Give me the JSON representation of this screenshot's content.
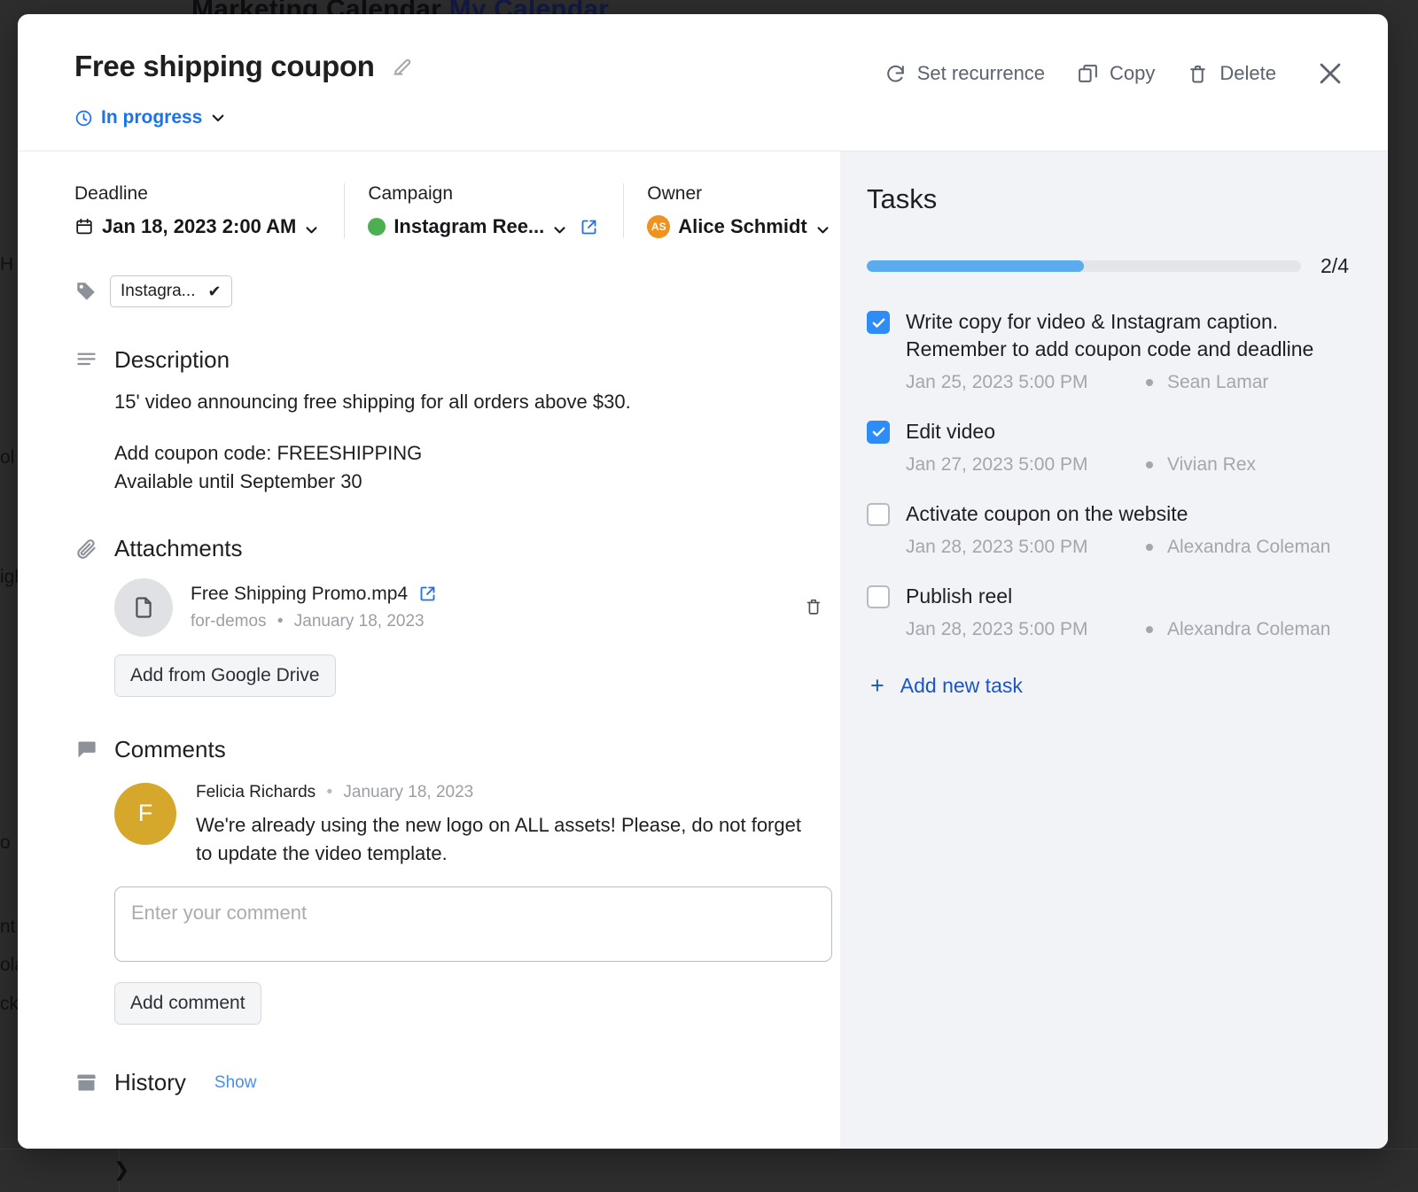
{
  "background": {
    "app_title": "Marketing Calendar",
    "app_subtitle": "My Calendar",
    "ghost_texts": [
      "H",
      "ol",
      "igh",
      "o",
      "nt",
      "ola",
      "ck"
    ]
  },
  "header": {
    "title": "Free shipping coupon",
    "edit_icon": "pencil-icon",
    "status": {
      "label": "In progress",
      "icon": "clock-icon",
      "color": "#1a73e8"
    },
    "actions": [
      {
        "label": "Set recurrence",
        "icon": "refresh-icon"
      },
      {
        "label": "Copy",
        "icon": "copy-icon"
      },
      {
        "label": "Delete",
        "icon": "trash-icon"
      }
    ],
    "close_icon": "close-icon"
  },
  "meta": {
    "deadline": {
      "label": "Deadline",
      "value": "Jan 18, 2023 2:00 AM",
      "icon": "calendar-icon"
    },
    "campaign": {
      "label": "Campaign",
      "value": "Instagram Ree...",
      "dot_color": "#4caf50",
      "external_icon": "external-link-icon"
    },
    "owner": {
      "label": "Owner",
      "value": "Alice Schmidt",
      "initials": "AS",
      "avatar_color": "#f0921f"
    }
  },
  "tag": {
    "icon": "tag-icon",
    "label": "Instagra...",
    "check": "✔"
  },
  "description": {
    "heading": "Description",
    "icon": "list-icon",
    "line1": "15' video announcing free shipping for all orders above $30.",
    "line2": "Add coupon code: FREESHIPPING",
    "line3": "Available until September 30"
  },
  "attachments": {
    "heading": "Attachments",
    "icon": "paperclip-icon",
    "items": [
      {
        "name": "Free Shipping Promo.mp4",
        "folder": "for-demos",
        "date": "January 18, 2023",
        "separator": "•",
        "open_icon": "external-link-icon",
        "delete_icon": "trash-icon"
      }
    ],
    "add_button": "Add from Google Drive"
  },
  "comments": {
    "heading": "Comments",
    "icon": "comment-icon",
    "items": [
      {
        "author": "Felicia Richards",
        "separator": "•",
        "date": "January 18, 2023",
        "initial": "F",
        "avatar_color": "#d5a72b",
        "text": "We're already using the new logo on ALL assets! Please, do not forget to update the video template."
      }
    ],
    "input_placeholder": "Enter your comment",
    "add_button": "Add comment"
  },
  "history": {
    "heading": "History",
    "icon": "archive-icon",
    "show_link": "Show"
  },
  "tasks": {
    "title": "Tasks",
    "progress_count": "2/4",
    "progress_percent": 50,
    "progress_color": "#5aabf0",
    "items": [
      {
        "label": "Write copy for video & Instagram caption. Remember to add coupon code and deadline",
        "done": true,
        "date": "Jan 25, 2023 5:00 PM",
        "assignee": "Sean Lamar"
      },
      {
        "label": "Edit video",
        "done": true,
        "date": "Jan 27, 2023 5:00 PM",
        "assignee": "Vivian Rex"
      },
      {
        "label": "Activate coupon on the website",
        "done": false,
        "date": "Jan 28, 2023 5:00 PM",
        "assignee": "Alexandra Coleman"
      },
      {
        "label": "Publish reel",
        "done": false,
        "date": "Jan 28, 2023 5:00 PM",
        "assignee": "Alexandra Coleman"
      }
    ],
    "add_label": "Add new task",
    "add_icon": "plus-icon"
  }
}
